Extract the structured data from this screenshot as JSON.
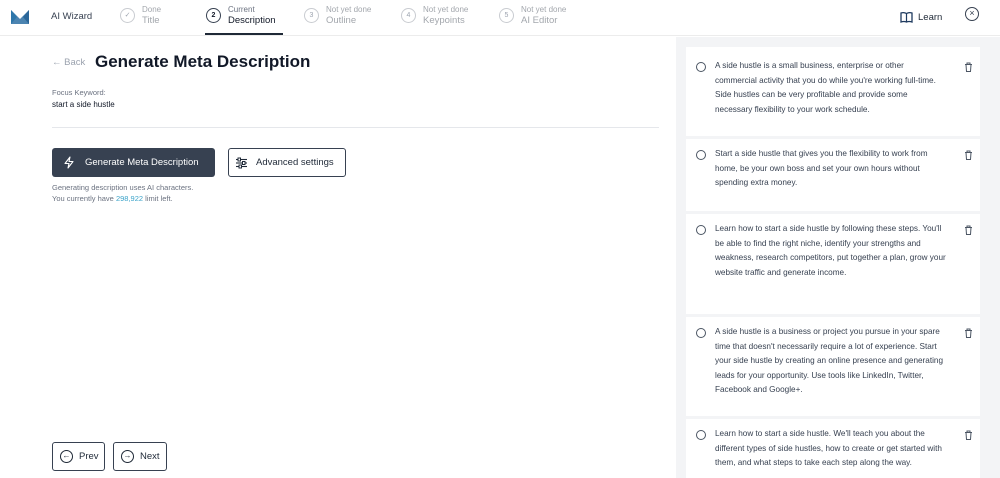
{
  "app": {
    "title": "AI Wizard"
  },
  "steps": [
    {
      "number": "✓",
      "status": "Done",
      "name": "Title"
    },
    {
      "number": "2",
      "status": "Current",
      "name": "Description"
    },
    {
      "number": "3",
      "status": "Not yet done",
      "name": "Outline"
    },
    {
      "number": "4",
      "status": "Not yet done",
      "name": "Keypoints"
    },
    {
      "number": "5",
      "status": "Not yet done",
      "name": "AI Editor"
    }
  ],
  "header": {
    "learn_label": "Learn",
    "close_icon": "×"
  },
  "main": {
    "back_label": "← Back",
    "title": "Generate Meta Description",
    "focus_keyword_label": "Focus Keyword:",
    "focus_keyword_value": "start a side hustle",
    "generate_button": "Generate Meta Description",
    "advanced_button": "Advanced settings",
    "note_line1": "Generating description uses AI characters.",
    "note_prefix": "You currently have ",
    "limit_count": "298,922",
    "note_suffix": " limit left.",
    "prev_label": "Prev",
    "next_label": "Next"
  },
  "descriptions": [
    {
      "text": "A side hustle is a small business, enterprise or other commercial activity that you do while you're working full-time. Side hustles can be very profitable and provide some necessary flexibility to your work schedule."
    },
    {
      "text": "Start a side hustle that gives you the flexibility to work from home, be your own boss and set your own hours without spending extra money."
    },
    {
      "text": "Learn how to start a side hustle by following these steps. You'll be able to find the right niche, identify your strengths and weakness, research competitors, put together a plan, grow your website traffic and generate income."
    },
    {
      "text": "A side hustle is a business or project you pursue in your spare time that doesn't necessarily require a lot of experience. Start your side hustle by creating an online presence and generating leads for your opportunity. Use tools like LinkedIn, Twitter, Facebook and Google+."
    },
    {
      "text": "Learn how to start a side hustle. We'll teach you about the different types of side hustles, how to create or get started with them, and what steps to take each step along the way."
    }
  ],
  "icons": {
    "logo": "logo-icon",
    "book": "book-icon",
    "close": "close-icon",
    "bolt": "bolt-icon",
    "sliders": "sliders-icon",
    "trash": "trash-icon",
    "radio": "radio-icon"
  },
  "colors": {
    "primary": "#374151",
    "highlight": "#3ba3c9",
    "logo": "#3aa8d8",
    "panel": "#f3f4f6"
  }
}
